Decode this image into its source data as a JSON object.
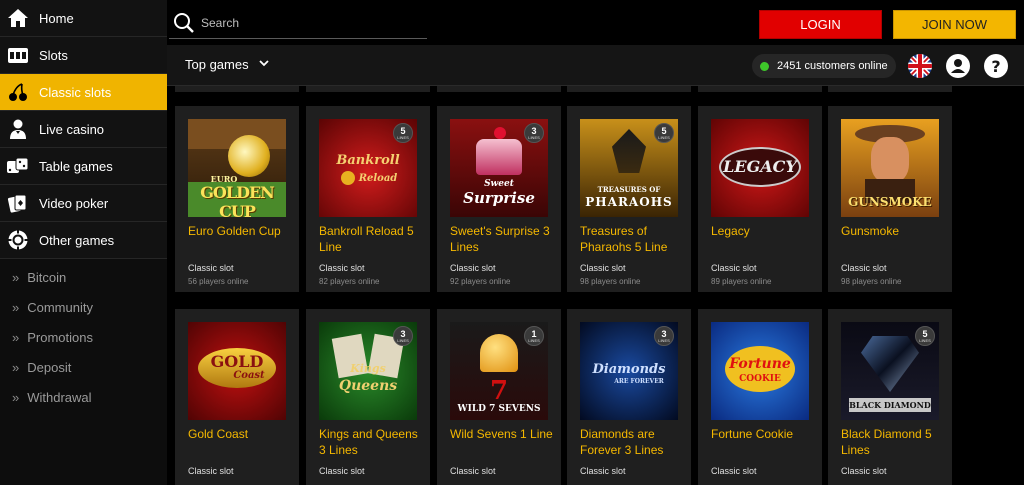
{
  "sidebar": {
    "items": [
      {
        "label": "Home",
        "icon": "home-icon"
      },
      {
        "label": "Slots",
        "icon": "slot-machine-icon"
      },
      {
        "label": "Classic slots",
        "icon": "cherries-icon",
        "active": true
      },
      {
        "label": "Live casino",
        "icon": "dealer-icon"
      },
      {
        "label": "Table games",
        "icon": "dice-icon"
      },
      {
        "label": "Video poker",
        "icon": "cards-icon"
      },
      {
        "label": "Other games",
        "icon": "chip-icon"
      }
    ],
    "links": [
      "Bitcoin",
      "Community",
      "Promotions",
      "Deposit",
      "Withdrawal"
    ]
  },
  "topbar": {
    "search_placeholder": "Search",
    "login_label": "LOGIN",
    "join_label": "JOIN NOW"
  },
  "subbar": {
    "filter_label": "Top games",
    "online_text": "2451 customers online",
    "icons": [
      "uk-flag-icon",
      "account-icon",
      "help-icon"
    ]
  },
  "colors": {
    "accent": "#f3b600",
    "login": "#e10000",
    "title": "#f5b800"
  },
  "games": [
    {
      "title": "Euro Golden Cup",
      "category": "Classic slot",
      "players": "56 players online",
      "lines": ""
    },
    {
      "title": "Bankroll Reload 5 Line",
      "category": "Classic slot",
      "players": "82 players online",
      "lines": "5"
    },
    {
      "title": "Sweet's Surprise 3 Lines",
      "category": "Classic slot",
      "players": "92 players online",
      "lines": "3"
    },
    {
      "title": "Treasures of Pharaohs 5 Line",
      "category": "Classic slot",
      "players": "98 players online",
      "lines": "5"
    },
    {
      "title": "Legacy",
      "category": "Classic slot",
      "players": "89 players online",
      "lines": ""
    },
    {
      "title": "Gunsmoke",
      "category": "Classic slot",
      "players": "98 players online",
      "lines": ""
    },
    {
      "title": "Gold Coast",
      "category": "Classic slot",
      "players": "",
      "lines": ""
    },
    {
      "title": "Kings and Queens 3 Lines",
      "category": "Classic slot",
      "players": "",
      "lines": "3"
    },
    {
      "title": "Wild Sevens 1 Line",
      "category": "Classic slot",
      "players": "",
      "lines": "1"
    },
    {
      "title": "Diamonds are Forever 3 Lines",
      "category": "Classic slot",
      "players": "",
      "lines": "3"
    },
    {
      "title": "Fortune Cookie",
      "category": "Classic slot",
      "players": "",
      "lines": ""
    },
    {
      "title": "Black Diamond 5 Lines",
      "category": "Classic slot",
      "players": "",
      "lines": "5"
    }
  ],
  "thumb_text": {
    "euro": "EURO",
    "golden_cup": "GOLDEN CUP",
    "bankroll": "Bankroll",
    "reload": "Reload",
    "sweet": "Sweet",
    "surprise": "Surprise",
    "treasures_of": "TREASURES OF",
    "pharaohs": "PHARAOHS",
    "legacy": "LEGACY",
    "gunsmoke": "GUNSMOKE",
    "gold": "GOLD",
    "coast": "Coast",
    "kings": "Kings",
    "queens": "Queens",
    "wild_sevens": "WILD 7 SEVENS",
    "diamonds": "Diamonds",
    "are_forever": "ARE FOREVER",
    "fortune": "Fortune",
    "cookie": "COOKIE",
    "black_diamond": "BLACK DIAMOND",
    "lines_word": "LINES"
  }
}
